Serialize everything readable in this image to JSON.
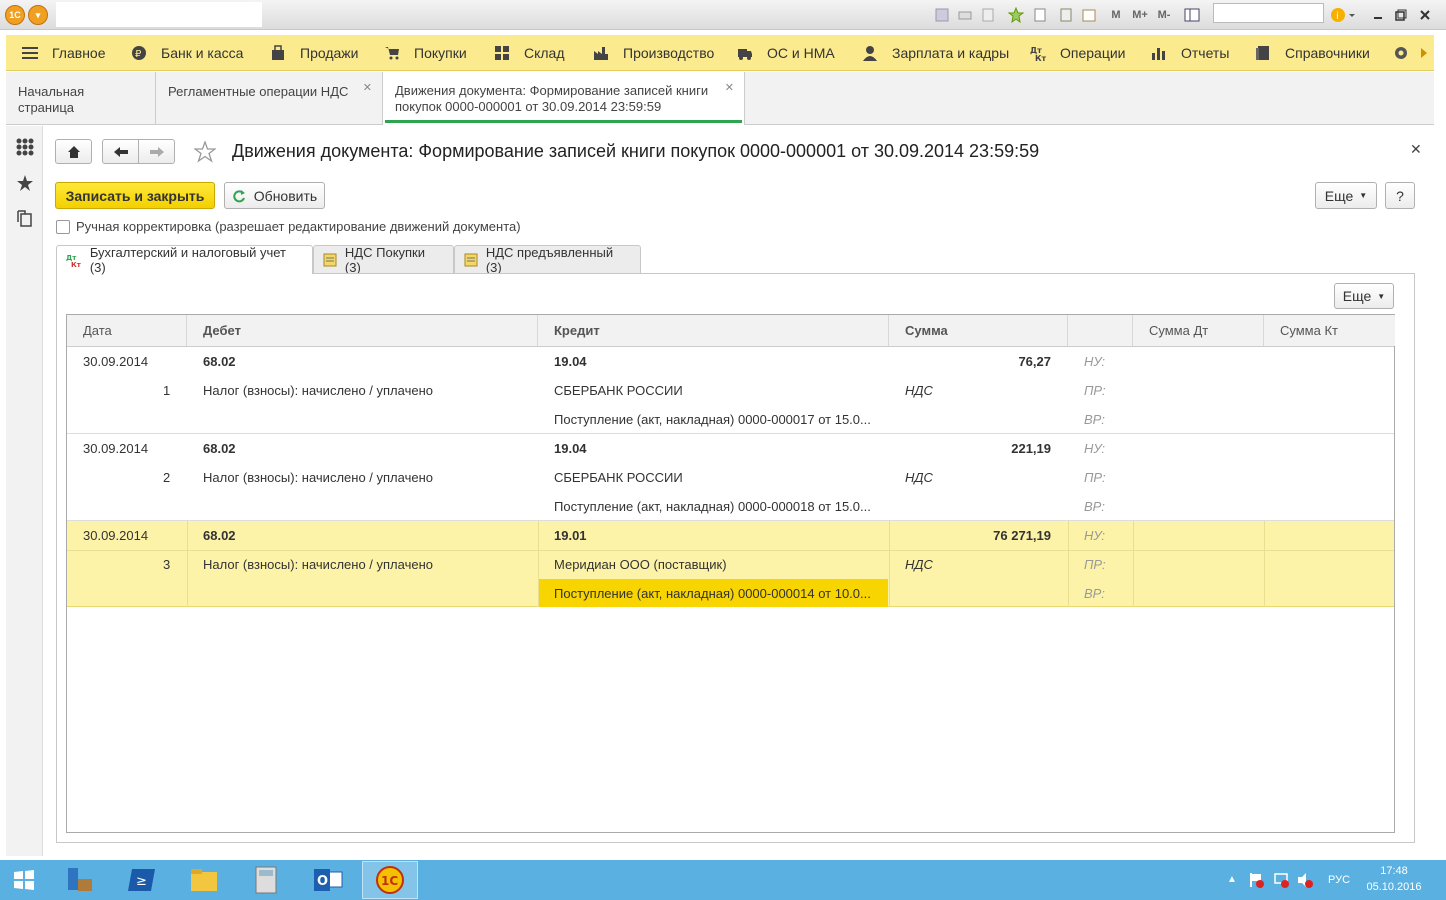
{
  "window": {
    "logo_text": "1С"
  },
  "toolbar": {
    "memory_m": "M",
    "memory_mplus": "M+",
    "memory_mminus": "M-"
  },
  "menu": [
    {
      "label": "Главное"
    },
    {
      "label": "Банк и касса"
    },
    {
      "label": "Продажи"
    },
    {
      "label": "Покупки"
    },
    {
      "label": "Склад"
    },
    {
      "label": "Производство"
    },
    {
      "label": "ОС и НМА"
    },
    {
      "label": "Зарплата и кадры"
    },
    {
      "label": "Операции"
    },
    {
      "label": "Отчеты"
    },
    {
      "label": "Справочники"
    }
  ],
  "tabs": [
    {
      "label": "Начальная страница"
    },
    {
      "label": "Регламентные операции НДС"
    },
    {
      "label": "Движения документа: Формирование записей книги покупок 0000-000001 от 30.09.2014 23:59:59"
    }
  ],
  "form": {
    "title": "Движения документа: Формирование записей книги покупок 0000-000001 от 30.09.2014 23:59:59",
    "save_close": "Записать и закрыть",
    "refresh": "Обновить",
    "more": "Еще",
    "help": "?",
    "manual_label": "Ручная корректировка (разрешает редактирование движений документа)"
  },
  "subtabs": [
    {
      "label": "Бухгалтерский и налоговый учет (3)"
    },
    {
      "label": "НДС Покупки (3)"
    },
    {
      "label": "НДС предъявленный (3)"
    }
  ],
  "grid": {
    "more": "Еще",
    "headers": {
      "date": "Дата",
      "debit": "Дебет",
      "credit": "Кредит",
      "sum": "Сумма",
      "sum_dt": "Сумма Дт",
      "sum_kt": "Сумма Кт"
    },
    "rows": [
      {
        "date": "30.09.2014",
        "n": "1",
        "debit": "68.02",
        "debit_sub": "Налог (взносы): начислено / уплачено",
        "credit": "19.04",
        "credit_sub1": "СБЕРБАНК РОССИИ",
        "credit_sub2": "Поступление (акт, накладная) 0000-000017 от 15.0...",
        "sum": "76,27",
        "sum_type": "НДС",
        "nu": "НУ:",
        "pr": "ПР:",
        "vr": "ВР:"
      },
      {
        "date": "30.09.2014",
        "n": "2",
        "debit": "68.02",
        "debit_sub": "Налог (взносы): начислено / уплачено",
        "credit": "19.04",
        "credit_sub1": "СБЕРБАНК РОССИИ",
        "credit_sub2": "Поступление (акт, накладная) 0000-000018 от 15.0...",
        "sum": "221,19",
        "sum_type": "НДС",
        "nu": "НУ:",
        "pr": "ПР:",
        "vr": "ВР:"
      },
      {
        "date": "30.09.2014",
        "n": "3",
        "debit": "68.02",
        "debit_sub": "Налог (взносы): начислено / уплачено",
        "credit": "19.01",
        "credit_sub1": "Меридиан ООО (поставщик)",
        "credit_sub2": "Поступление (акт, накладная) 0000-000014 от 10.0...",
        "sum": "76 271,19",
        "sum_type": "НДС",
        "nu": "НУ:",
        "pr": "ПР:",
        "vr": "ВР:"
      }
    ]
  },
  "taskbar": {
    "lang": "РУС",
    "time": "17:48",
    "date": "05.10.2016"
  },
  "colors": {
    "menu_bg": "#fbeb8e",
    "selected_row": "#fdf3a8",
    "selected_cell": "#f8d400",
    "accent": "#2fa44f"
  }
}
